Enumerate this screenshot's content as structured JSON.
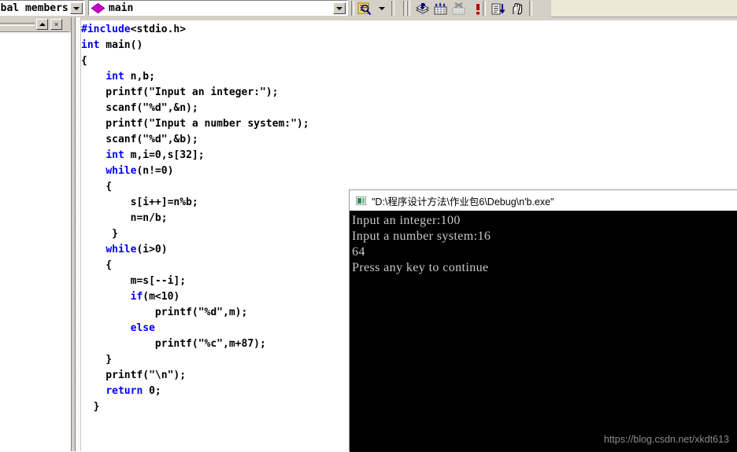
{
  "toolbar": {
    "scope_combo": {
      "value": "lobal members",
      "full_value": "Global members",
      "name": "globals-combo"
    },
    "member_combo": {
      "value": "main",
      "icon": "magenta-diamond-icon"
    },
    "find_combo": {
      "icon": "find-in-files-icon"
    },
    "buttons": [
      {
        "name": "compile-icon",
        "label": "Compile"
      },
      {
        "name": "build-icon",
        "label": "Build"
      },
      {
        "name": "stop-build-icon",
        "label": "Stop Build"
      },
      {
        "name": "execute-program-icon",
        "label": "Execute Program"
      },
      {
        "name": "go-debug-icon",
        "label": "Go"
      },
      {
        "name": "insert-breakpoint-icon",
        "label": "Insert/Remove Breakpoint"
      }
    ]
  },
  "left_pane": {
    "restore_button": "restore-button",
    "close_button": "×"
  },
  "editor": {
    "lines": [
      [
        {
          "t": "#include",
          "c": "pp"
        },
        {
          "t": "<stdio.h>",
          "c": ""
        }
      ],
      [
        {
          "t": "int",
          "c": "kw"
        },
        {
          "t": " main()",
          "c": ""
        }
      ],
      [
        {
          "t": "{",
          "c": ""
        }
      ],
      [
        {
          "t": "    ",
          "c": ""
        },
        {
          "t": "int",
          "c": "kw"
        },
        {
          "t": " n,b;",
          "c": ""
        }
      ],
      [
        {
          "t": "    printf(\"Input an integer:\");",
          "c": ""
        }
      ],
      [
        {
          "t": "    scanf(\"%d\",&n);",
          "c": ""
        }
      ],
      [
        {
          "t": "    printf(\"Input a number system:\");",
          "c": ""
        }
      ],
      [
        {
          "t": "    scanf(\"%d\",&b);",
          "c": ""
        }
      ],
      [
        {
          "t": "    ",
          "c": ""
        },
        {
          "t": "int",
          "c": "kw"
        },
        {
          "t": " m,i=0,s[32];",
          "c": ""
        }
      ],
      [
        {
          "t": "    ",
          "c": ""
        },
        {
          "t": "while",
          "c": "kw"
        },
        {
          "t": "(n!=0)",
          "c": ""
        }
      ],
      [
        {
          "t": "    {",
          "c": ""
        }
      ],
      [
        {
          "t": "        s[i++]=n%b;",
          "c": ""
        }
      ],
      [
        {
          "t": "        n=n/b;",
          "c": ""
        }
      ],
      [
        {
          "t": "     }",
          "c": ""
        }
      ],
      [
        {
          "t": "    ",
          "c": ""
        },
        {
          "t": "while",
          "c": "kw"
        },
        {
          "t": "(i>0)",
          "c": ""
        }
      ],
      [
        {
          "t": "    {",
          "c": ""
        }
      ],
      [
        {
          "t": "        m=s[--i];",
          "c": ""
        }
      ],
      [
        {
          "t": "        ",
          "c": ""
        },
        {
          "t": "if",
          "c": "kw"
        },
        {
          "t": "(m<10)",
          "c": ""
        }
      ],
      [
        {
          "t": "            printf(\"%d\",m);",
          "c": ""
        }
      ],
      [
        {
          "t": "        ",
          "c": ""
        },
        {
          "t": "else",
          "c": "kw"
        }
      ],
      [
        {
          "t": "            printf(\"%c\",m+87);",
          "c": ""
        }
      ],
      [
        {
          "t": "    }",
          "c": ""
        }
      ],
      [
        {
          "t": "    printf(\"\\n\");",
          "c": ""
        }
      ],
      [
        {
          "t": "    ",
          "c": ""
        },
        {
          "t": "return",
          "c": "kw"
        },
        {
          "t": " 0;",
          "c": ""
        }
      ],
      [
        {
          "t": "  }",
          "c": ""
        }
      ]
    ]
  },
  "console": {
    "title": "\"D:\\程序设计方法\\作业包6\\Debug\\n'b.exe\"",
    "icon": "console-app-icon",
    "output": "Input an integer:100\nInput a number system:16\n64\nPress any key to continue"
  },
  "watermark": {
    "text": "https://blog.csdn.net/xkdt613"
  },
  "colors": {
    "keyword": "#0000ff",
    "toolbar_bg": "#d4d0c8",
    "console_bg": "#000000",
    "console_fg": "#c8c8c8",
    "diamond": "#cc00cc"
  }
}
